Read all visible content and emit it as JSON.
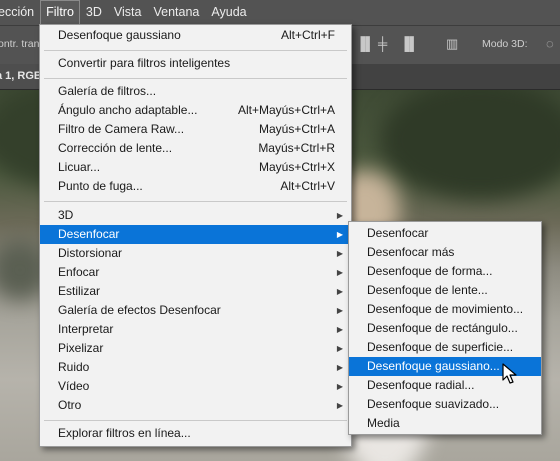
{
  "menubar": {
    "items": [
      "ección",
      "Filtro",
      "3D",
      "Vista",
      "Ventana",
      "Ayuda"
    ]
  },
  "options_bar": {
    "left_label": "ontr. tran",
    "mode_3d_label": "Modo 3D:"
  },
  "tab": {
    "label": "a 1, RGB"
  },
  "filter_menu": {
    "items": [
      {
        "label": "Desenfoque gaussiano",
        "shortcut": "Alt+Ctrl+F"
      },
      {
        "label": "Convertir para filtros inteligentes",
        "shortcut": ""
      },
      {
        "label": "Galería de filtros...",
        "shortcut": ""
      },
      {
        "label": "Ángulo ancho adaptable...",
        "shortcut": "Alt+Mayús+Ctrl+A"
      },
      {
        "label": "Filtro de Camera Raw...",
        "shortcut": "Mayús+Ctrl+A"
      },
      {
        "label": "Corrección de lente...",
        "shortcut": "Mayús+Ctrl+R"
      },
      {
        "label": "Licuar...",
        "shortcut": "Mayús+Ctrl+X"
      },
      {
        "label": "Punto de fuga...",
        "shortcut": "Alt+Ctrl+V"
      },
      {
        "label": "3D",
        "shortcut": ""
      },
      {
        "label": "Desenfocar",
        "shortcut": ""
      },
      {
        "label": "Distorsionar",
        "shortcut": ""
      },
      {
        "label": "Enfocar",
        "shortcut": ""
      },
      {
        "label": "Estilizar",
        "shortcut": ""
      },
      {
        "label": "Galería de efectos Desenfocar",
        "shortcut": ""
      },
      {
        "label": "Interpretar",
        "shortcut": ""
      },
      {
        "label": "Pixelizar",
        "shortcut": ""
      },
      {
        "label": "Ruido",
        "shortcut": ""
      },
      {
        "label": "Vídeo",
        "shortcut": ""
      },
      {
        "label": "Otro",
        "shortcut": ""
      },
      {
        "label": "Explorar filtros en línea...",
        "shortcut": ""
      }
    ]
  },
  "blur_submenu": {
    "items": [
      "Desenfocar",
      "Desenfocar más",
      "Desenfoque de forma...",
      "Desenfoque de lente...",
      "Desenfoque de movimiento...",
      "Desenfoque de rectángulo...",
      "Desenfoque de superficie...",
      "Desenfoque gaussiano...",
      "Desenfoque radial...",
      "Desenfoque suavizado...",
      "Media"
    ]
  },
  "colors": {
    "highlight": "#0a74d8",
    "menu_bg": "#f2f2f2",
    "chrome": "#535353"
  }
}
